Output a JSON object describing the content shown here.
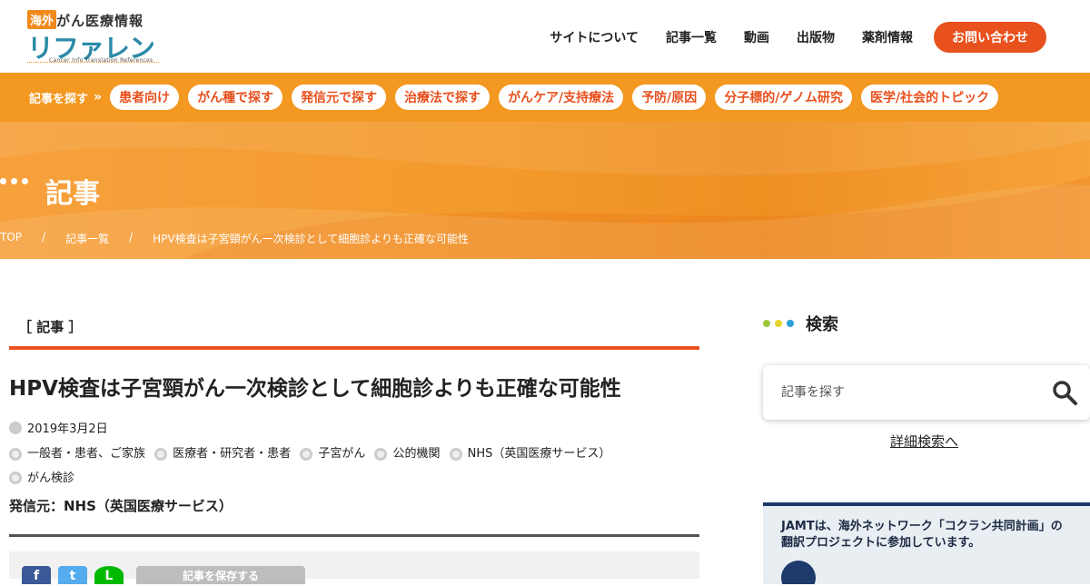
{
  "header": {
    "logo_badge": "海外",
    "logo_sub": "がん医療情報",
    "logo_main": "リファレンス",
    "logo_en": "Cancer Info Translation References",
    "nav": [
      "サイトについて",
      "記事一覧",
      "動画",
      "出版物",
      "薬剤情報"
    ],
    "contact": "お問い合わせ"
  },
  "catbar": {
    "label": "記事を探す",
    "chevron": "»",
    "pills": [
      "患者向け",
      "がん種で探す",
      "発信元で探す",
      "治療法で探す",
      "がんケア/支持療法",
      "予防/原因",
      "分子標的/ゲノム研究",
      "医学/社会的トピック"
    ]
  },
  "hero": {
    "title": "記事",
    "breadcrumb": [
      "TOP",
      "/",
      "記事一覧",
      "/",
      "HPV検査は子宮頸がん一次検診として細胞診よりも正確な可能性"
    ]
  },
  "article": {
    "kicker": "［ 記事 ］",
    "title": "HPV検査は子宮頸がん一次検診として細胞診よりも正確な可能性",
    "date": "2019年3月2日",
    "tags": [
      "一般者・患者、ご家族",
      "医療者・研究者・患者",
      "子宮がん",
      "公的機関",
      "NHS（英国医療サービス）",
      "がん検診"
    ],
    "source": "発信元：NHS（英国医療サービス）",
    "share": {
      "facebook": "f",
      "twitter": "t",
      "line": "L",
      "save": "記事を保存する"
    }
  },
  "sidebar": {
    "heading": "検索",
    "search_placeholder": "記事を探す",
    "advanced_link": "詳細検索へ",
    "banner_text": "JAMTは、海外ネットワーク「コクラン共同計画」の\n翻訳プロジェクトに参加しています。",
    "dot_colors": [
      "#9bc53d",
      "#e6d42a",
      "#2a9fd6"
    ]
  },
  "colors": {
    "accent": "#e8501d",
    "orange": "#f39820",
    "brand": "#2b8aa7"
  }
}
